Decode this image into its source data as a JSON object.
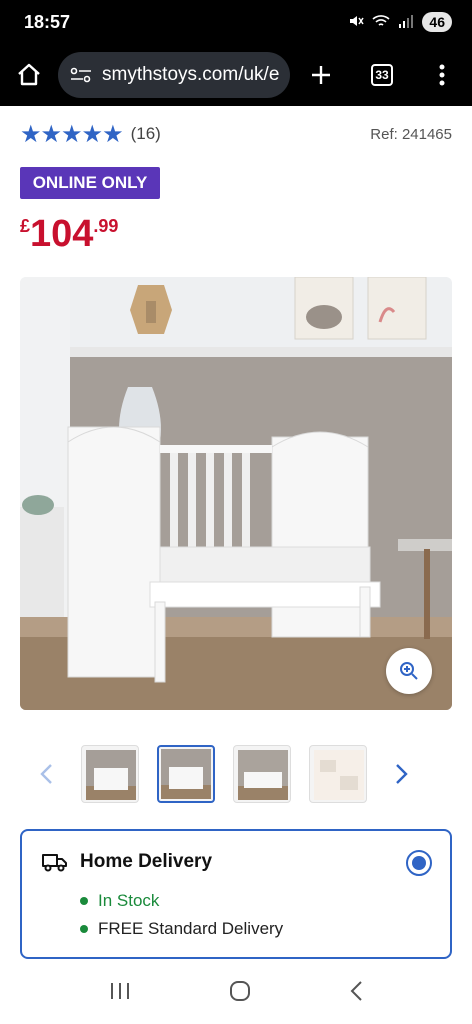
{
  "status_bar": {
    "time": "18:57",
    "battery": "46"
  },
  "browser": {
    "url": "smythstoys.com/uk/e",
    "tab_count": "33"
  },
  "product": {
    "rating_stars": "★★★★★",
    "review_count": "(16)",
    "ref": "Ref: 241465",
    "badge": "ONLINE ONLY",
    "price_symbol": "£",
    "price_main": "104",
    "price_decimal": ".99"
  },
  "delivery": {
    "title": "Home Delivery",
    "stock": "In Stock",
    "shipping": "FREE Standard Delivery"
  },
  "colors": {
    "accent": "#2f64c5",
    "badge": "#5a36b8",
    "price": "#c8102e",
    "in_stock": "#1a8a3b"
  }
}
